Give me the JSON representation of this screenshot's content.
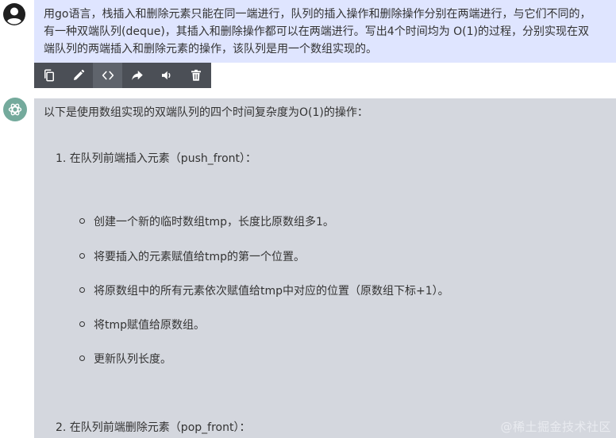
{
  "user_message": {
    "lines": [
      "用go语言，栈插入和删除元素只能在同一端进行，队列的插入操作和删除操作分别在两端进行，与它们不同的，",
      "有一种双端队列(deque)，其插入和删除操作都可以在两端进行。写出4个时间均为 O(1)的过程，分别实现在双",
      "端队列的两端插入和删除元素的操作，该队列是用一个数组实现的。"
    ]
  },
  "toolbar": {
    "buttons": [
      {
        "name": "copy-button",
        "icon": "copy-icon"
      },
      {
        "name": "edit-button",
        "icon": "pencil-icon"
      },
      {
        "name": "code-button",
        "icon": "code-icon"
      },
      {
        "name": "share-button",
        "icon": "share-arrow-icon"
      },
      {
        "name": "speak-button",
        "icon": "speaker-icon"
      },
      {
        "name": "delete-button",
        "icon": "trash-icon"
      }
    ],
    "active_index": 2
  },
  "assistant_message": {
    "intro": "以下是使用数组实现的双端队列的四个时间复杂度为O(1)的操作：",
    "sections": [
      {
        "heading": "1. 在队列前端插入元素（push_front）：",
        "steps": [
          "创建一个新的临时数组tmp，长度比原数组多1。",
          "将要插入的元素赋值给tmp的第一个位置。",
          "将原数组中的所有元素依次赋值给tmp中对应的位置（原数组下标+1）。",
          "将tmp赋值给原数组。",
          "更新队列长度。"
        ]
      },
      {
        "heading": "2. 在队列前端删除元素（pop_front）："
      }
    ]
  },
  "watermark": "@稀土掘金技术社区",
  "colors": {
    "user_bubble": "#dfe5ff",
    "assistant_bubble": "#d4d7de",
    "toolbar": "#4b4f56",
    "gpt_brand": "#74aa9c"
  }
}
